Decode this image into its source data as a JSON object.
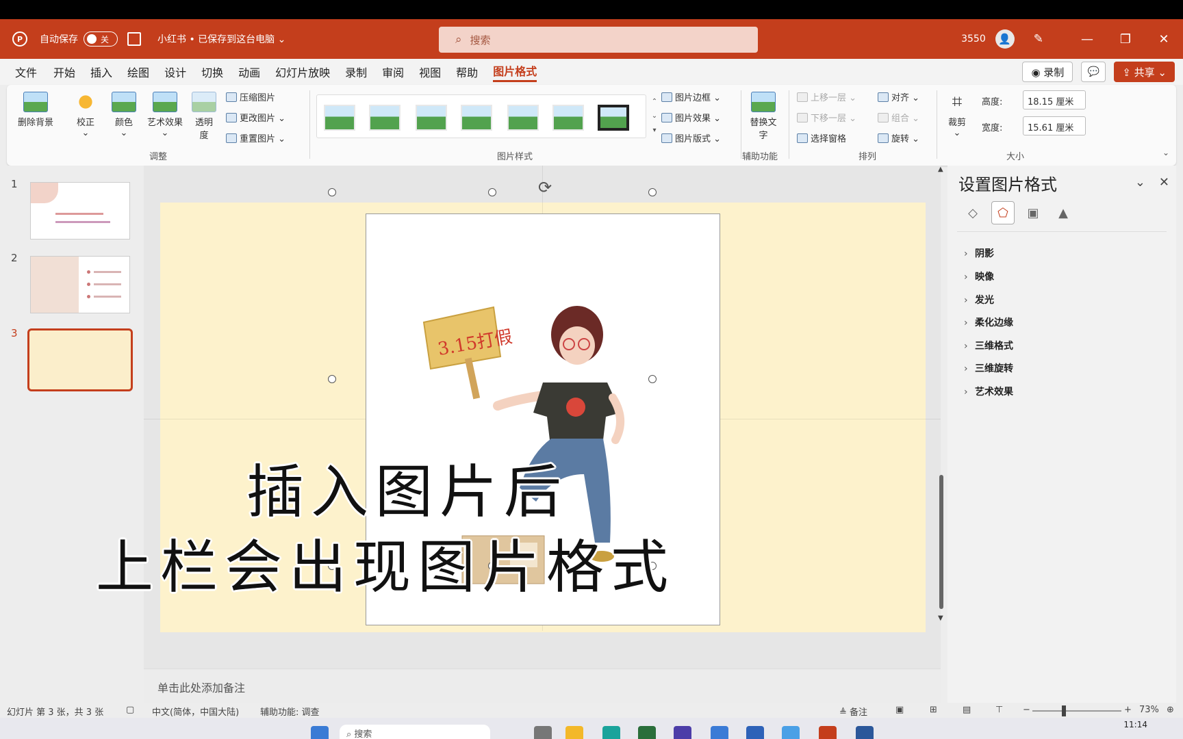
{
  "titlebar": {
    "autosave_label": "自动保存",
    "autosave_state": "关",
    "doc_name": "小红书 • 已保存到这台电脑 ⌄",
    "search_placeholder": "搜索",
    "user": "3550",
    "minimize": "—",
    "restore": "❐",
    "close": "✕"
  },
  "menu": {
    "tabs": [
      "文件",
      "开始",
      "插入",
      "绘图",
      "设计",
      "切换",
      "动画",
      "幻灯片放映",
      "录制",
      "审阅",
      "视图",
      "帮助",
      "图片格式"
    ],
    "active_tab": "图片格式",
    "record": "◉ 录制",
    "share": "⇪ 共享 ⌄"
  },
  "ribbon": {
    "remove_bg": "删除背景",
    "correct": "校正",
    "color": "颜色",
    "art_effects": "艺术效果",
    "transparency": "透明度",
    "compress": "压缩图片",
    "change_pic": "更改图片",
    "reset_pic": "重置图片",
    "group_adjust": "调整",
    "group_styles": "图片样式",
    "pic_border": "图片边框",
    "pic_effects": "图片效果",
    "pic_layout": "图片版式",
    "alt_text": "替换文字",
    "group_access": "辅助功能",
    "bring_forward": "上移一层",
    "send_backward": "下移一层",
    "selection_pane": "选择窗格",
    "align": "对齐",
    "group": "组合",
    "rotate": "旋转",
    "group_arrange": "排列",
    "crop": "裁剪",
    "height_label": "高度:",
    "height_value": "18.15 厘米",
    "width_label": "宽度:",
    "width_value": "15.61 厘米",
    "group_size": "大小"
  },
  "slides": {
    "numbers": [
      "1",
      "2",
      "3"
    ],
    "current": 3
  },
  "canvas": {
    "overlay_line1": "插入图片后",
    "overlay_line2": "上栏会出现图片格式",
    "sign_text": "3.15打假",
    "notes_placeholder": "单击此处添加备注"
  },
  "format_pane": {
    "title": "设置图片格式",
    "sections": [
      "阴影",
      "映像",
      "发光",
      "柔化边缘",
      "三维格式",
      "三维旋转",
      "艺术效果"
    ]
  },
  "status": {
    "slide_info": "幻灯片 第 3 张，共 3 张",
    "language": "中文(简体，中国大陆)",
    "accessibility": "辅助功能: 调查",
    "notes": "备注",
    "zoom": "73%"
  },
  "taskbar": {
    "search": "搜索",
    "time": "11:14"
  },
  "colors": {
    "accent": "#c43e1c",
    "slide_bg": "#fdf2cc"
  }
}
